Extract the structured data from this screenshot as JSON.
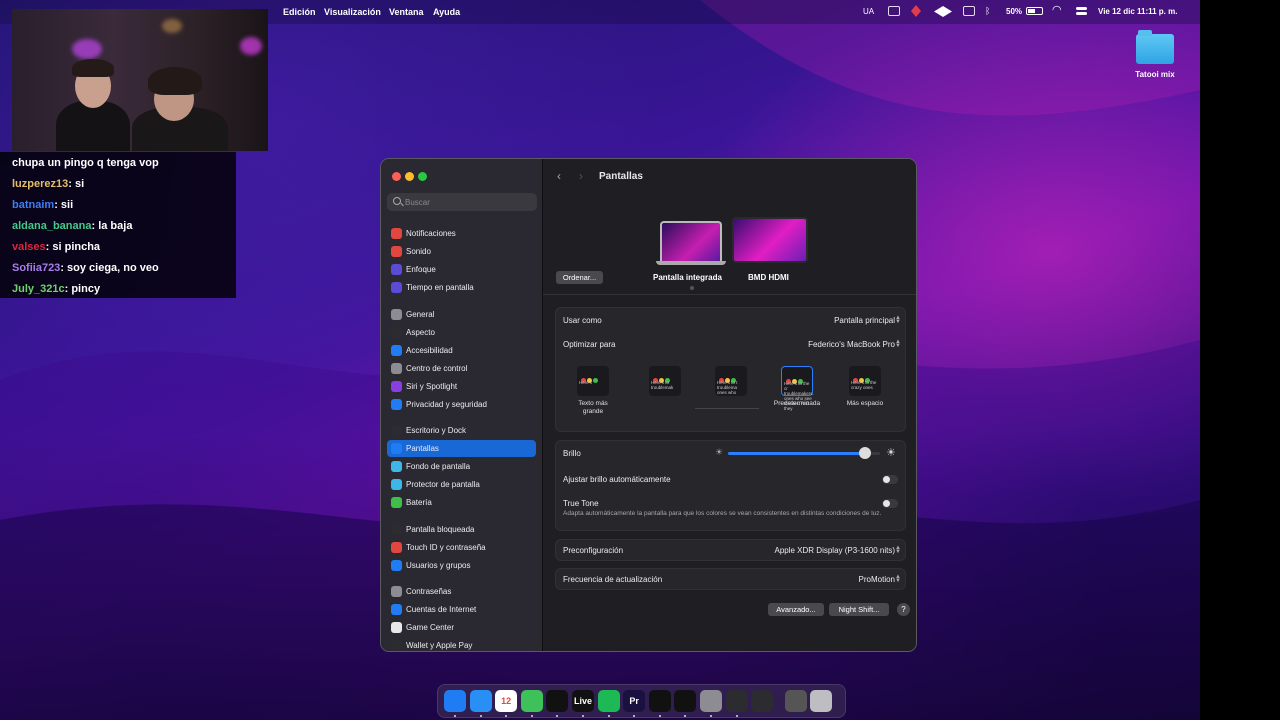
{
  "menubar": {
    "items": [
      "Edición",
      "Visualización",
      "Ventana",
      "Ayuda"
    ],
    "status": {
      "input_source": "UA",
      "battery": "50%",
      "datetime": "Vie 12 dic  11:11 p. m."
    }
  },
  "desktop": {
    "folder_label": "Tatooi mix"
  },
  "chat": [
    {
      "user": "",
      "message": "chupa un pingo q tenga vop",
      "color": "#ffffff"
    },
    {
      "user": "luzperez13",
      "message": ": si",
      "color": "#e2c06a"
    },
    {
      "user": "batnaim",
      "message": ": sii",
      "color": "#3d7ef5"
    },
    {
      "user": "aldana_banana",
      "message": ": la baja",
      "color": "#44c98a"
    },
    {
      "user": "valses",
      "message": ": si pincha",
      "color": "#d8283f"
    },
    {
      "user": "Sofiia723",
      "message": ": soy ciega, no veo",
      "color": "#a77de8"
    },
    {
      "user": "July_321c",
      "message": ": pincy",
      "color": "#6fd26f"
    }
  ],
  "window": {
    "title": "Pantallas",
    "search_placeholder": "Buscar",
    "sidebar": [
      {
        "label": "Notificaciones",
        "icon": "bell-icon",
        "color": "#e2473f"
      },
      {
        "label": "Sonido",
        "icon": "speaker-icon",
        "color": "#e2473f"
      },
      {
        "label": "Enfoque",
        "icon": "moon-icon",
        "color": "#5b4bd6"
      },
      {
        "label": "Tiempo en pantalla",
        "icon": "hourglass-icon",
        "color": "#5b4bd6"
      },
      {
        "label": "General",
        "icon": "gear-icon",
        "color": "#8c8c92"
      },
      {
        "label": "Aspecto",
        "icon": "appearance-icon",
        "color": "#2b2b30"
      },
      {
        "label": "Accesibilidad",
        "icon": "accessibility-icon",
        "color": "#1f7cf2"
      },
      {
        "label": "Centro de control",
        "icon": "control-center-icon",
        "color": "#8c8c92"
      },
      {
        "label": "Siri y Spotlight",
        "icon": "siri-icon",
        "color": "#8a3ee0"
      },
      {
        "label": "Privacidad y seguridad",
        "icon": "hand-icon",
        "color": "#1f7cf2"
      },
      {
        "label": "Escritorio y Dock",
        "icon": "dock-icon",
        "color": "#2b2b30"
      },
      {
        "label": "Pantallas",
        "icon": "sun-icon",
        "color": "#1f7cf2"
      },
      {
        "label": "Fondo de pantalla",
        "icon": "wallpaper-icon",
        "color": "#3fb6e8"
      },
      {
        "label": "Protector de pantalla",
        "icon": "screensaver-icon",
        "color": "#3fb6e8"
      },
      {
        "label": "Batería",
        "icon": "battery-icon",
        "color": "#3fbf4a"
      },
      {
        "label": "Pantalla bloqueada",
        "icon": "lock-screen-icon",
        "color": "#2b2b30"
      },
      {
        "label": "Touch ID y contraseña",
        "icon": "fingerprint-icon",
        "color": "#e2473f"
      },
      {
        "label": "Usuarios y grupos",
        "icon": "users-icon",
        "color": "#1f7cf2"
      },
      {
        "label": "Contraseñas",
        "icon": "key-icon",
        "color": "#8c8c92"
      },
      {
        "label": "Cuentas de Internet",
        "icon": "at-icon",
        "color": "#1f7cf2"
      },
      {
        "label": "Game Center",
        "icon": "game-center-icon",
        "color": "#e8e8ea"
      },
      {
        "label": "Wallet y Apple Pay",
        "icon": "wallet-icon",
        "color": "#2b2b30"
      }
    ],
    "active_sidebar_index": 11,
    "displays": {
      "arrange_button": "Ordenar...",
      "items": [
        {
          "label": "Pantalla integrada"
        },
        {
          "label": "BMD HDMI"
        }
      ]
    },
    "settings": {
      "use_as": {
        "label": "Usar como",
        "value": "Pantalla principal"
      },
      "optimize_for": {
        "label": "Optimizar para",
        "value": "Federico's MacBook Pro"
      },
      "resolutions": [
        {
          "label": "Texto más grande",
          "preview": "Here's"
        },
        {
          "label": "",
          "preview": "Here's to troublemak"
        },
        {
          "label": "",
          "preview": "Here's to t troublema ones who"
        },
        {
          "label": "Predeterminada",
          "preview": "Here's to the cr troublemakers. ones who see th rules. And they"
        },
        {
          "label": "Más espacio",
          "preview": "Here's to the crazy ones"
        }
      ],
      "selected_resolution_index": 3,
      "brightness": {
        "label": "Brillo",
        "level": 0.9
      },
      "auto_brightness": {
        "label": "Ajustar brillo automáticamente",
        "on": false
      },
      "true_tone": {
        "label": "True Tone",
        "description": "Adapta automáticamente la pantalla para que los colores se vean consistentes en distintas condiciones de luz.",
        "on": false
      },
      "preset": {
        "label": "Preconfiguración",
        "value": "Apple XDR Display (P3-1600 nits)"
      },
      "refresh_rate": {
        "label": "Frecuencia de actualización",
        "value": "ProMotion"
      }
    },
    "buttons": {
      "advanced": "Avanzado...",
      "night_shift": "Night Shift...",
      "help": "?"
    }
  },
  "dock": [
    {
      "name": "finder-icon",
      "color": "#1f7cf2",
      "glyph": ""
    },
    {
      "name": "safari-icon",
      "color": "#2a8ff5",
      "glyph": ""
    },
    {
      "name": "calendar-icon",
      "color": "#ffffff",
      "glyph": "12"
    },
    {
      "name": "whatsapp-icon",
      "color": "#3fc15a",
      "glyph": ""
    },
    {
      "name": "capcut-icon",
      "color": "#111111",
      "glyph": ""
    },
    {
      "name": "live-icon",
      "color": "#111111",
      "glyph": "Live"
    },
    {
      "name": "spotify-icon",
      "color": "#1db954",
      "glyph": ""
    },
    {
      "name": "premiere-icon",
      "color": "#1a1140",
      "glyph": "Pr"
    },
    {
      "name": "cube-icon",
      "color": "#111111",
      "glyph": ""
    },
    {
      "name": "tidal-icon",
      "color": "#111111",
      "glyph": ""
    },
    {
      "name": "settings-icon",
      "color": "#8c8c92",
      "glyph": ""
    },
    {
      "name": "app-icon",
      "color": "#2b2b30",
      "glyph": ""
    },
    {
      "name": "obs-icon",
      "color": "#2b2b30",
      "glyph": ""
    },
    {
      "name": "downloads-icon",
      "color": "#555",
      "glyph": ""
    },
    {
      "name": "trash-icon",
      "color": "#bdbdc2",
      "glyph": ""
    }
  ]
}
